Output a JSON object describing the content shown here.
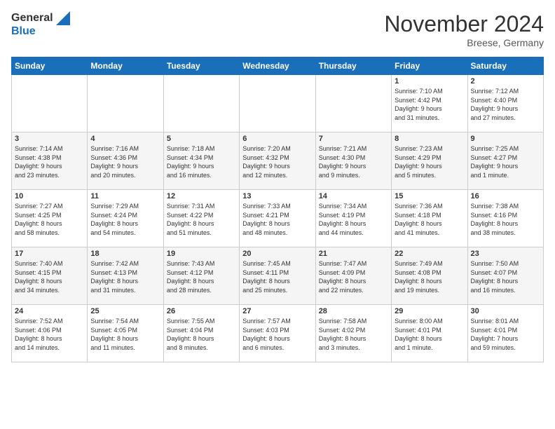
{
  "header": {
    "logo_general": "General",
    "logo_blue": "Blue",
    "month_title": "November 2024",
    "location": "Breese, Germany"
  },
  "weekdays": [
    "Sunday",
    "Monday",
    "Tuesday",
    "Wednesday",
    "Thursday",
    "Friday",
    "Saturday"
  ],
  "weeks": [
    [
      {
        "day": "",
        "info": ""
      },
      {
        "day": "",
        "info": ""
      },
      {
        "day": "",
        "info": ""
      },
      {
        "day": "",
        "info": ""
      },
      {
        "day": "",
        "info": ""
      },
      {
        "day": "1",
        "info": "Sunrise: 7:10 AM\nSunset: 4:42 PM\nDaylight: 9 hours\nand 31 minutes."
      },
      {
        "day": "2",
        "info": "Sunrise: 7:12 AM\nSunset: 4:40 PM\nDaylight: 9 hours\nand 27 minutes."
      }
    ],
    [
      {
        "day": "3",
        "info": "Sunrise: 7:14 AM\nSunset: 4:38 PM\nDaylight: 9 hours\nand 23 minutes."
      },
      {
        "day": "4",
        "info": "Sunrise: 7:16 AM\nSunset: 4:36 PM\nDaylight: 9 hours\nand 20 minutes."
      },
      {
        "day": "5",
        "info": "Sunrise: 7:18 AM\nSunset: 4:34 PM\nDaylight: 9 hours\nand 16 minutes."
      },
      {
        "day": "6",
        "info": "Sunrise: 7:20 AM\nSunset: 4:32 PM\nDaylight: 9 hours\nand 12 minutes."
      },
      {
        "day": "7",
        "info": "Sunrise: 7:21 AM\nSunset: 4:30 PM\nDaylight: 9 hours\nand 9 minutes."
      },
      {
        "day": "8",
        "info": "Sunrise: 7:23 AM\nSunset: 4:29 PM\nDaylight: 9 hours\nand 5 minutes."
      },
      {
        "day": "9",
        "info": "Sunrise: 7:25 AM\nSunset: 4:27 PM\nDaylight: 9 hours\nand 1 minute."
      }
    ],
    [
      {
        "day": "10",
        "info": "Sunrise: 7:27 AM\nSunset: 4:25 PM\nDaylight: 8 hours\nand 58 minutes."
      },
      {
        "day": "11",
        "info": "Sunrise: 7:29 AM\nSunset: 4:24 PM\nDaylight: 8 hours\nand 54 minutes."
      },
      {
        "day": "12",
        "info": "Sunrise: 7:31 AM\nSunset: 4:22 PM\nDaylight: 8 hours\nand 51 minutes."
      },
      {
        "day": "13",
        "info": "Sunrise: 7:33 AM\nSunset: 4:21 PM\nDaylight: 8 hours\nand 48 minutes."
      },
      {
        "day": "14",
        "info": "Sunrise: 7:34 AM\nSunset: 4:19 PM\nDaylight: 8 hours\nand 44 minutes."
      },
      {
        "day": "15",
        "info": "Sunrise: 7:36 AM\nSunset: 4:18 PM\nDaylight: 8 hours\nand 41 minutes."
      },
      {
        "day": "16",
        "info": "Sunrise: 7:38 AM\nSunset: 4:16 PM\nDaylight: 8 hours\nand 38 minutes."
      }
    ],
    [
      {
        "day": "17",
        "info": "Sunrise: 7:40 AM\nSunset: 4:15 PM\nDaylight: 8 hours\nand 34 minutes."
      },
      {
        "day": "18",
        "info": "Sunrise: 7:42 AM\nSunset: 4:13 PM\nDaylight: 8 hours\nand 31 minutes."
      },
      {
        "day": "19",
        "info": "Sunrise: 7:43 AM\nSunset: 4:12 PM\nDaylight: 8 hours\nand 28 minutes."
      },
      {
        "day": "20",
        "info": "Sunrise: 7:45 AM\nSunset: 4:11 PM\nDaylight: 8 hours\nand 25 minutes."
      },
      {
        "day": "21",
        "info": "Sunrise: 7:47 AM\nSunset: 4:09 PM\nDaylight: 8 hours\nand 22 minutes."
      },
      {
        "day": "22",
        "info": "Sunrise: 7:49 AM\nSunset: 4:08 PM\nDaylight: 8 hours\nand 19 minutes."
      },
      {
        "day": "23",
        "info": "Sunrise: 7:50 AM\nSunset: 4:07 PM\nDaylight: 8 hours\nand 16 minutes."
      }
    ],
    [
      {
        "day": "24",
        "info": "Sunrise: 7:52 AM\nSunset: 4:06 PM\nDaylight: 8 hours\nand 14 minutes."
      },
      {
        "day": "25",
        "info": "Sunrise: 7:54 AM\nSunset: 4:05 PM\nDaylight: 8 hours\nand 11 minutes."
      },
      {
        "day": "26",
        "info": "Sunrise: 7:55 AM\nSunset: 4:04 PM\nDaylight: 8 hours\nand 8 minutes."
      },
      {
        "day": "27",
        "info": "Sunrise: 7:57 AM\nSunset: 4:03 PM\nDaylight: 8 hours\nand 6 minutes."
      },
      {
        "day": "28",
        "info": "Sunrise: 7:58 AM\nSunset: 4:02 PM\nDaylight: 8 hours\nand 3 minutes."
      },
      {
        "day": "29",
        "info": "Sunrise: 8:00 AM\nSunset: 4:01 PM\nDaylight: 8 hours\nand 1 minute."
      },
      {
        "day": "30",
        "info": "Sunrise: 8:01 AM\nSunset: 4:01 PM\nDaylight: 7 hours\nand 59 minutes."
      }
    ]
  ]
}
